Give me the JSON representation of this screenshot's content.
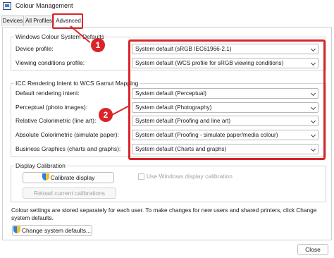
{
  "window": {
    "title": "Colour Management",
    "icon": "monitor-icon"
  },
  "tabs": [
    {
      "label": "Devices"
    },
    {
      "label": "All Profiles"
    },
    {
      "label": "Advanced",
      "active": true
    }
  ],
  "wcs_defaults": {
    "group_label": "Windows Colour System Defaults",
    "rows": [
      {
        "label": "Device profile:",
        "value": "System default (sRGB IEC61966-2.1)"
      },
      {
        "label": "Viewing conditions profile:",
        "value": "System default (WCS profile for sRGB viewing conditions)"
      }
    ]
  },
  "icc_mapping": {
    "group_label": "ICC Rendering Intent to WCS Gamut Mapping",
    "rows": [
      {
        "label": "Default rendering intent:",
        "value": "System default (Perceptual)"
      },
      {
        "label": "Perceptual (photo images):",
        "value": "System default (Photography)"
      },
      {
        "label": "Relative Colorimetric (line art):",
        "value": "System default (Proofing and line art)"
      },
      {
        "label": "Absolute Colorimetric (simulate paper):",
        "value": "System default (Proofing - simulate paper/media colour)"
      },
      {
        "label": "Business Graphics (charts and graphs):",
        "value": "System default (Charts and graphs)"
      }
    ]
  },
  "display_calibration": {
    "group_label": "Display Calibration",
    "calibrate_button": "Calibrate display",
    "use_windows_calibration": {
      "label": "Use Windows display calibration",
      "checked": false,
      "enabled": false
    },
    "reload_button": "Reload current calibrations"
  },
  "footer": {
    "info_text": "Colour settings are stored separately for each user. To make changes for new users and shared printers, click Change system defaults.",
    "change_defaults_button": "Change system defaults...",
    "close_button": "Close"
  },
  "annotations": [
    {
      "number": "1"
    },
    {
      "number": "2"
    }
  ],
  "colors": {
    "annotation_red": "#d9242a",
    "shield_blue": "#2f7fd8",
    "shield_yellow": "#f4c222"
  }
}
